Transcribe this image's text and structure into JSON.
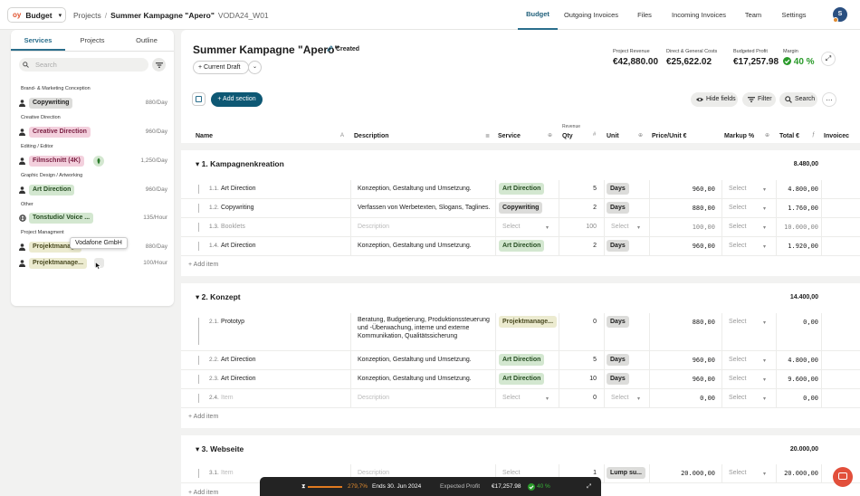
{
  "header": {
    "logo": "oy",
    "app_name": "Budget",
    "breadcrumb": [
      "Projects",
      "/",
      "Summer Kampagne \"Apero\"",
      "VODA24_W01"
    ],
    "nav": [
      "Budget",
      "Outgoing Invoices",
      "Files",
      "Incoming Invoices",
      "Team",
      "Settings"
    ],
    "avatar": "S"
  },
  "sidebar": {
    "tabs": [
      "Services",
      "Projects",
      "Outline"
    ],
    "search_placeholder": "Search",
    "groups": [
      "Brand- & Marketing Conception",
      "Creative Direction",
      "Editing / Editor",
      "Graphic Design / Artworking",
      "Other",
      "Project Managment"
    ],
    "services": [
      {
        "label": "Copywriting",
        "rate": "880/Day",
        "bg": "#dcdcda",
        "fg": "#222222"
      },
      {
        "label": "Creative Direction",
        "rate": "960/Day",
        "bg": "#f3d0dd",
        "fg": "#7a1f42"
      },
      {
        "label": "Filmschnitt (4K)",
        "rate": "1,250/Day",
        "bg": "#f3d0dd",
        "fg": "#7a1f42"
      },
      {
        "label": "Art Direction",
        "rate": "960/Day",
        "bg": "#d3e7d0",
        "fg": "#264d22"
      },
      {
        "label": "Tonstudio/ Voice ...",
        "rate": "135/Hour",
        "bg": "#d3e7d0",
        "fg": "#264d22"
      },
      {
        "label": "Projektmanage...",
        "rate": "880/Day",
        "bg": "#ecebd0",
        "fg": "#4a4a20"
      },
      {
        "label": "Projektmanage...",
        "rate": "100/Hour",
        "bg": "#ecebd0",
        "fg": "#4a4a20"
      }
    ],
    "tooltip": "Vodafone GmbH"
  },
  "project": {
    "title": "Summer Kampagne \"Apero\"",
    "status": "Created",
    "draft": "+ Current Draft",
    "kpis": [
      {
        "label": "Project Revenue",
        "value": "€42,880.00"
      },
      {
        "label": "Direct & General Costs",
        "value": "€25,622.02"
      },
      {
        "label": "Budgeted Profit",
        "value": "€17,257.98"
      },
      {
        "label": "Margin",
        "value": "40 %"
      }
    ]
  },
  "toolbar": {
    "add_section": "+ Add section",
    "hide_fields": "Hide fields",
    "filter": "Filter",
    "search": "Search"
  },
  "columns": {
    "name": "Name",
    "description": "Description",
    "service": "Service",
    "revenue": "Revenue",
    "qty": "Qty",
    "unit": "Unit",
    "price": "Price/Unit €",
    "markup": "Markup %",
    "total": "Total €",
    "invoiced": "Invoicec",
    "name_icon": "A"
  },
  "sections": [
    {
      "title": "1. Kampagnenkreation",
      "total": "8.480,00",
      "rows": [
        {
          "num": "1.1.",
          "name": "Art Direction",
          "desc": "Konzeption, Gestaltung und Umsetzung.",
          "service": "Art Direction",
          "qty": "5",
          "unit": "Days",
          "price": "960,00",
          "markup": "Select",
          "total": "4.800,00"
        },
        {
          "num": "1.2.",
          "name": "Copywriting",
          "desc": "Verfassen von Werbetexten, Slogans, Taglines.",
          "service": "Copywriting",
          "qty": "2",
          "unit": "Days",
          "price": "880,00",
          "markup": "Select",
          "total": "1.760,00"
        },
        {
          "num": "1.3.",
          "name": "Booklets",
          "desc": "Description",
          "service": "Select",
          "qty": "100",
          "unit": "Select",
          "price": "100,00",
          "markup": "Select",
          "total": "10.000,00"
        },
        {
          "num": "1.4.",
          "name": "Art Direction",
          "desc": "Konzeption, Gestaltung und Umsetzung.",
          "service": "Art Direction",
          "qty": "2",
          "unit": "Days",
          "price": "960,00",
          "markup": "Select",
          "total": "1.920,00"
        }
      ]
    },
    {
      "title": "2. Konzept",
      "total": "14.400,00",
      "rows": [
        {
          "num": "2.1.",
          "name": "Prototyp",
          "desc": "Beratung, Budgetierung, Produktionssteuerung und -Überwachung, interne und externe Kommunikation, Qualitätssicherung",
          "service": "Projektmanage...",
          "qty": "0",
          "unit": "Days",
          "price": "880,00",
          "markup": "Select",
          "total": "0,00"
        },
        {
          "num": "2.2.",
          "name": "Art Direction",
          "desc": "Konzeption, Gestaltung und Umsetzung.",
          "service": "Art Direction",
          "qty": "5",
          "unit": "Days",
          "price": "960,00",
          "markup": "Select",
          "total": "4.800,00"
        },
        {
          "num": "2.3.",
          "name": "Art Direction",
          "desc": "Konzeption, Gestaltung und Umsetzung.",
          "service": "Art Direction",
          "qty": "10",
          "unit": "Days",
          "price": "960,00",
          "markup": "Select",
          "total": "9.600,00"
        },
        {
          "num": "2.4.",
          "name": "Item",
          "desc": "Description",
          "service": "Select",
          "qty": "0",
          "unit": "Select",
          "price": "0,00",
          "markup": "Select",
          "total": "0,00"
        }
      ]
    },
    {
      "title": "3. Webseite",
      "total": "20.000,00",
      "rows": [
        {
          "num": "3.1.",
          "name": "Item",
          "desc": "Description",
          "service": "Select",
          "qty": "1",
          "unit": "Lump su...",
          "price": "20.000,00",
          "markup": "Select",
          "total": "20.000,00"
        }
      ]
    }
  ],
  "add_item": "+ Add item",
  "bottom_bar": {
    "percent": "279,7%",
    "ends": "Ends 30. Jun 2024",
    "profit_label": "Expected Profit",
    "profit_value": "€17,257.98",
    "margin": "40 %"
  }
}
